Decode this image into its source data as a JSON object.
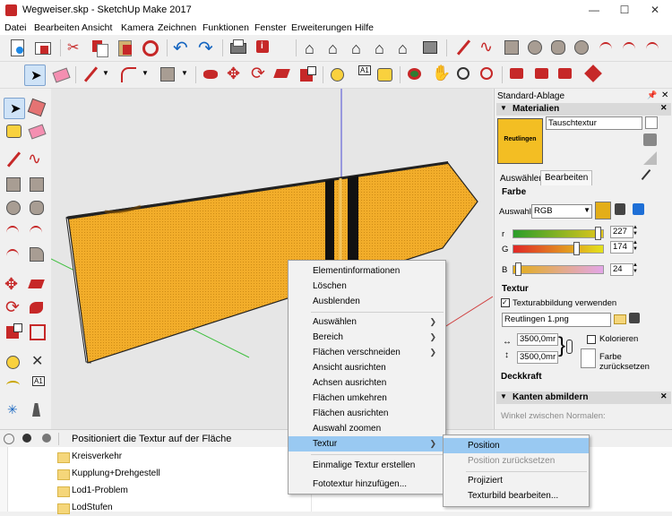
{
  "window": {
    "title": "Wegweiser.skp - SketchUp Make 2017",
    "minimize": "—",
    "maximize": "☐",
    "close": "✕"
  },
  "menu": [
    "Datei",
    "Bearbeiten",
    "Ansicht",
    "Kamera",
    "Zeichnen",
    "Funktionen",
    "Fenster",
    "Erweiterungen",
    "Hilfe"
  ],
  "status": {
    "text": "Positioniert die Textur auf der Fläche"
  },
  "explorer": {
    "items": [
      "Kreisverkehr",
      "Kupplung+Drehgestell",
      "Lod1-Problem",
      "LodStufen"
    ]
  },
  "tray": {
    "title": "Standard-Ablage",
    "materials_header": "Materialien",
    "material_name": "Tauschtextur",
    "swatch_label": "Reutlingen",
    "tabs": [
      "Auswählen",
      "Bearbeiten"
    ],
    "farbe_label": "Farbe",
    "auswahl_label": "Auswahl:",
    "color_model": "RGB",
    "r_label": "r",
    "g_label": "G",
    "b_label": "B",
    "r_value": "227",
    "g_value": "174",
    "b_value": "24",
    "textur_label": "Textur",
    "use_texture_label": "Texturabbildung verwenden",
    "texture_file": "Reutlingen 1.png",
    "width": "3500,0mr",
    "height": "3500,0mr",
    "colorize_label": "Kolorieren",
    "reset_color_label": "Farbe zurücksetzen",
    "opacity_label": "Deckkraft",
    "edges_header": "Kanten abmildern",
    "normals_label": "Winkel zwischen Normalen:",
    "material_color": "#e3ae18"
  },
  "context_menu": {
    "items": [
      {
        "label": "Elementinformationen",
        "sub": false
      },
      {
        "label": "Löschen",
        "sub": false
      },
      {
        "label": "Ausblenden",
        "sub": false
      },
      {
        "label": "Auswählen",
        "sub": true
      },
      {
        "label": "Bereich",
        "sub": true
      },
      {
        "label": "Flächen verschneiden",
        "sub": true
      },
      {
        "label": "Ansicht ausrichten",
        "sub": false
      },
      {
        "label": "Achsen ausrichten",
        "sub": false
      },
      {
        "label": "Flächen umkehren",
        "sub": false
      },
      {
        "label": "Flächen ausrichten",
        "sub": false
      },
      {
        "label": "Auswahl zoomen",
        "sub": false
      },
      {
        "label": "Textur",
        "sub": true
      },
      {
        "label": "Einmalige Textur erstellen",
        "sub": false
      },
      {
        "label": "Fototextur hinzufügen...",
        "sub": false
      }
    ]
  },
  "submenu": {
    "items": [
      {
        "label": "Position",
        "disabled": false
      },
      {
        "label": "Position zurücksetzen",
        "disabled": true
      },
      {
        "label": "Projiziert",
        "disabled": false
      },
      {
        "label": "Texturbild bearbeiten...",
        "disabled": false
      }
    ]
  }
}
